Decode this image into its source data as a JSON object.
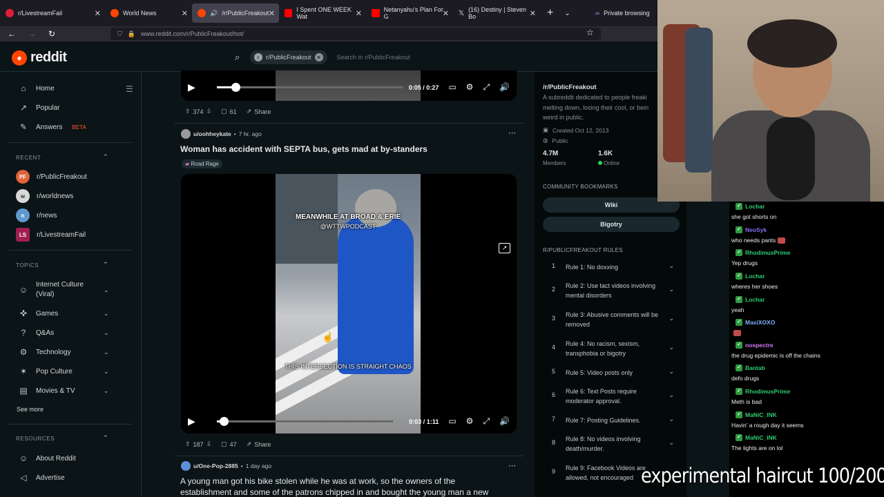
{
  "browser": {
    "tabs": [
      {
        "label": "r/LivestreamFail",
        "color": "#e01e3c"
      },
      {
        "label": "World News",
        "color": "#ff4500"
      },
      {
        "label": "/r/PublicFreakout",
        "color": "#ff4500"
      },
      {
        "label": "I Spent ONE WEEK Wat",
        "color": "#ff0000"
      },
      {
        "label": "Netanyahu's Plan For G",
        "color": "#ff0000"
      },
      {
        "label": "(16) Destiny | Steven Bo",
        "color": "#ffffff"
      }
    ],
    "private_label": "Private browsing",
    "url": "www.reddit.com/r/PublicFreakout/hot/"
  },
  "header": {
    "logo": "reddit",
    "search_chip": "r/PublicFreakout",
    "search_placeholder": "Search in r/PublicFreakout"
  },
  "sidebar": {
    "nav": [
      {
        "label": "Home",
        "icon": "home-icon"
      },
      {
        "label": "Popular",
        "icon": "popular-icon"
      },
      {
        "label": "Answers",
        "badge": "BETA",
        "icon": "answers-icon"
      }
    ],
    "recent_title": "RECENT",
    "recent": [
      {
        "label": "r/PublicFreakout",
        "color": "#e0633a"
      },
      {
        "label": "r/worldnews",
        "color": "#d9d9d9"
      },
      {
        "label": "r/news",
        "color": "#5f99cf"
      },
      {
        "label": "r/LivestreamFail",
        "color": "#a01e4f"
      }
    ],
    "topics_title": "TOPICS",
    "topics": [
      {
        "label": "Internet Culture (Viral)"
      },
      {
        "label": "Games"
      },
      {
        "label": "Q&As"
      },
      {
        "label": "Technology"
      },
      {
        "label": "Pop Culture"
      },
      {
        "label": "Movies & TV"
      }
    ],
    "see_more": "See more",
    "resources_title": "RESOURCES",
    "resources": [
      {
        "label": "About Reddit"
      },
      {
        "label": "Advertise"
      }
    ]
  },
  "feed": {
    "prev_post": {
      "time": "0:05 / 0:27",
      "progress": 0.1,
      "votes": "374",
      "comments": "61",
      "share": "Share"
    },
    "post": {
      "user": "u/oohheykate",
      "age": "7 hr. ago",
      "title": "Woman has accident with SEPTA bus, gets mad at by-standers",
      "flair": "Road Rage",
      "caption_top_1": "MEANWHILE AT BROAD & ERIE",
      "caption_top_2": "@WTTWPODCAST",
      "caption_bottom": "THIS INTERSECTION IS STRAIGHT CHAOS",
      "time": "0:03 / 1:11",
      "progress": 0.04,
      "votes": "187",
      "comments": "47",
      "share": "Share"
    },
    "next_post": {
      "user": "u/One-Pop-2885",
      "age": "1 day ago",
      "title_line1": "A young man got his bike stolen while he was at work, so the owners of the",
      "title_line2": "establishment and some of the patrons chipped in and bought the young man a new"
    }
  },
  "community": {
    "name": "/r/PublicFreakout",
    "desc_line1": "A subreddit dedicated to people freaki",
    "desc_line2": "melting down, losing their cool, or bein",
    "desc_line3": "weird in public.",
    "created": "Created Oct 12, 2013",
    "visibility": "Public",
    "members": "4.7M",
    "members_label": "Members",
    "online": "1.6K",
    "online_label": "Online",
    "bookmarks_title": "COMMUNITY BOOKMARKS",
    "bookmarks": [
      "Wiki",
      "Bigotry"
    ],
    "rules_title": "R/PUBLICFREAKOUT RULES",
    "rules": [
      {
        "n": "1",
        "text": "Rule 1: No doxxing"
      },
      {
        "n": "2",
        "text": "Rule 2: Use tact videos involving mental disorders"
      },
      {
        "n": "3",
        "text": "Rule 3: Abusive comments will be removed"
      },
      {
        "n": "4",
        "text": "Rule 4: No racism, sexism, transphobia or bigotry"
      },
      {
        "n": "5",
        "text": "Rule 5: Video posts only"
      },
      {
        "n": "6",
        "text": "Rule 6: Text Posts require moderator approval."
      },
      {
        "n": "7",
        "text": "Rule 7: Posting Guidelines."
      },
      {
        "n": "8",
        "text": "Rule 8: No videos involving death/murder."
      },
      {
        "n": "9",
        "text": "Rule 9: Facebook Videos are allowed, not encouraged"
      }
    ]
  },
  "chat": [
    {
      "name": "Lochar",
      "color": "#2ecc71",
      "text": "she got shorts on"
    },
    {
      "name": "NeoSyk",
      "color": "#8a6cf0",
      "text": "who needs pants"
    },
    {
      "name": "RhodimusPrime",
      "color": "#2ecc71",
      "text": "Yep drugs"
    },
    {
      "name": "Lochar",
      "color": "#2ecc71",
      "text": "wheres her shoes"
    },
    {
      "name": "Lochar",
      "color": "#2ecc71",
      "text": "yeah"
    },
    {
      "name": "MaxiXOXO",
      "color": "#7fb2ff",
      "text": ""
    },
    {
      "name": "nospectre",
      "color": "#d07cf2",
      "text": "the drug epidemic is off the chains"
    },
    {
      "name": "Bantab",
      "color": "#2ecc71",
      "text": "defo drugs"
    },
    {
      "name": "RhodimusPrime",
      "color": "#2ecc71",
      "text": "Meth is bad"
    },
    {
      "name": "MaNiC_INK",
      "color": "#2ecc71",
      "text": "Havin' a rough day it seems"
    },
    {
      "name": "MaNiC_INK",
      "color": "#2ecc71",
      "text": "The lights are on lol"
    }
  ],
  "overlay": "experimental haircut 100/200"
}
